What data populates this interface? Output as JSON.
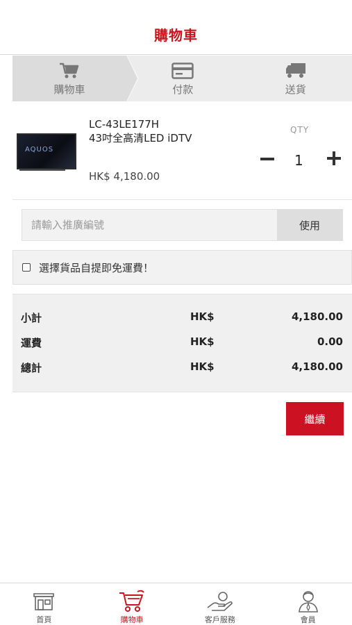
{
  "header": {
    "title": "購物車"
  },
  "steps": [
    {
      "label": "購物車",
      "icon": "cart-icon",
      "active": true
    },
    {
      "label": "付款",
      "icon": "credit-card-icon",
      "active": false
    },
    {
      "label": "送貨",
      "icon": "truck-icon",
      "active": false
    }
  ],
  "product": {
    "model": "LC-43LE177H",
    "name": "43吋全高清LED iDTV",
    "price": "HK$ 4,180.00",
    "image_logo": "AQUOS",
    "qty_label": "QTY",
    "quantity": "1"
  },
  "promo": {
    "placeholder": "請輸入推廣編號",
    "button_label": "使用"
  },
  "pickup": {
    "label": "選擇貨品自提即免運費！",
    "checked": false
  },
  "summary": {
    "rows": [
      {
        "label": "小計",
        "currency": "HK$",
        "amount": "4,180.00"
      },
      {
        "label": "運費",
        "currency": "HK$",
        "amount": "0.00"
      },
      {
        "label": "總計",
        "currency": "HK$",
        "amount": "4,180.00"
      }
    ]
  },
  "continue_label": "繼續",
  "nav": [
    {
      "label": "首頁",
      "icon": "home-icon",
      "active": false
    },
    {
      "label": "購物車",
      "icon": "shopping-cart-icon",
      "active": true
    },
    {
      "label": "客戶服務",
      "icon": "customer-service-icon",
      "active": false
    },
    {
      "label": "會員",
      "icon": "member-icon",
      "active": false
    }
  ],
  "colors": {
    "brand_red": "#c8151d",
    "button_red": "#cc1222",
    "panel_gray": "#f0f0f0"
  }
}
